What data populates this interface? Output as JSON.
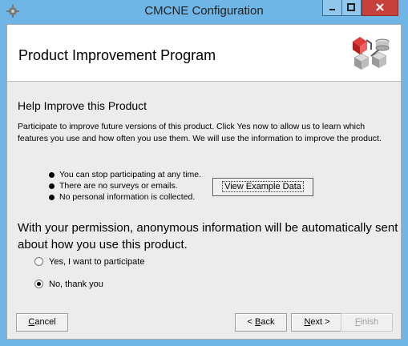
{
  "window": {
    "title": "CMCNE Configuration"
  },
  "header": {
    "title": "Product Improvement Program"
  },
  "section": {
    "title": "Help Improve this Product"
  },
  "intro": "Participate to improve future versions of this product. Click Yes now to allow us to learn which features you use and how often you use them. We will use the information to improve the product.",
  "bullets": [
    "You can stop participating at any time.",
    "There are no surveys or emails.",
    "No personal information is collected."
  ],
  "view_example_label": "View Example Data",
  "permission_text": "With your permission, anonymous information will be automatically sent about how you use this product.",
  "options": [
    {
      "label": "Yes, I want to participate",
      "selected": false
    },
    {
      "label": "No, thank you",
      "selected": true
    }
  ],
  "buttons": {
    "cancel": {
      "pre": "",
      "key": "C",
      "post": "ancel"
    },
    "back": {
      "pre": "< ",
      "key": "B",
      "post": "ack"
    },
    "next": {
      "pre": "",
      "key": "N",
      "post": "ext >"
    },
    "finish": {
      "pre": "",
      "key": "F",
      "post": "inish"
    }
  },
  "colors": {
    "title_bar": "#6fb6e6",
    "close_button": "#c7403a",
    "dialog_bg": "#ececec"
  }
}
